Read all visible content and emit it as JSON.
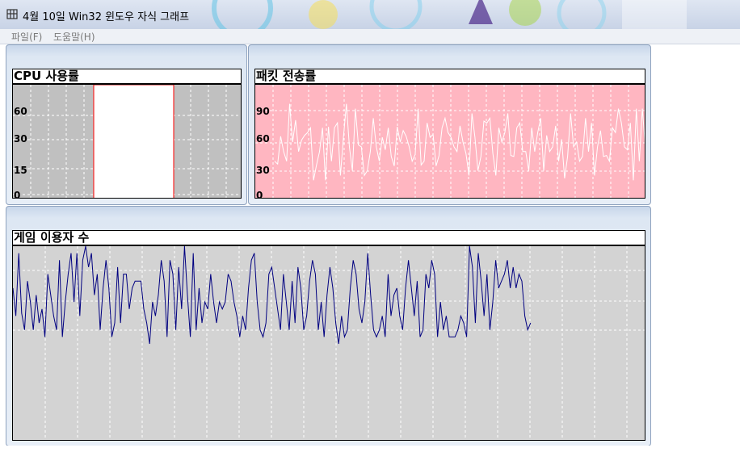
{
  "window": {
    "title": "4월 10일 Win32 윈도우 자식 그래프",
    "icon": "app-window-icon"
  },
  "menu": {
    "file": "파일(F)",
    "help": "도움말(H)"
  },
  "colors": {
    "cpu_bg": "#c0c0c0",
    "cpu_bar_fill": "#ffffff",
    "cpu_bar_border": "#ff0000",
    "packet_bg": "#ffb6c1",
    "packet_line": "#ffffff",
    "users_bg": "#d3d3d3",
    "users_line": "#000080",
    "grid": "#ffffff"
  },
  "charts": {
    "cpu": {
      "title": "CPU 사용률",
      "y_ticks": [
        "60",
        "30",
        "15",
        "0"
      ]
    },
    "packet": {
      "title": "패킷 전송률",
      "y_ticks": [
        "90",
        "60",
        "30",
        "0"
      ]
    },
    "users": {
      "title": "게임 이용자 수"
    }
  },
  "chart_data": [
    {
      "type": "bar",
      "title": "CPU 사용률",
      "ylim": [
        0,
        80
      ],
      "y_ticks": [
        0,
        15,
        30,
        60
      ],
      "values": [
        80
      ]
    },
    {
      "type": "line",
      "title": "패킷 전송률",
      "ylim": [
        0,
        120
      ],
      "y_ticks": [
        0,
        30,
        60,
        90
      ],
      "values": [
        40,
        37,
        66,
        50,
        40,
        100,
        60,
        83,
        50,
        62,
        67,
        70,
        75,
        20,
        36,
        50,
        75,
        20,
        76,
        40,
        75,
        80,
        25,
        65,
        100,
        55,
        30,
        95,
        57,
        55,
        25,
        30,
        50,
        85,
        55,
        40,
        65,
        52,
        75,
        45,
        35,
        76,
        60,
        72,
        66,
        55,
        40,
        47,
        95,
        36,
        40,
        80,
        65,
        68,
        35,
        46,
        75,
        85,
        70,
        65,
        55,
        50,
        77,
        60,
        48,
        25,
        90,
        65,
        30,
        45,
        82,
        80,
        85,
        48,
        25,
        75,
        60,
        70,
        90,
        46,
        45,
        75,
        80,
        50,
        50,
        30,
        75,
        50,
        70,
        85,
        30,
        67,
        50,
        55,
        77,
        40,
        63,
        22,
        45,
        90,
        55,
        60,
        40,
        45,
        85,
        50,
        80,
        25,
        55,
        72,
        45,
        46,
        40,
        75,
        70,
        95,
        80,
        55,
        52,
        80,
        20,
        95,
        40,
        95,
        55,
        70,
        90,
        56,
        82,
        72
      ]
    },
    {
      "type": "line",
      "title": "게임 이용자 수",
      "ylim": [
        0,
        140
      ],
      "values": [
        110,
        90,
        135,
        92,
        80,
        115,
        100,
        80,
        105,
        85,
        95,
        75,
        120,
        105,
        90,
        80,
        130,
        75,
        100,
        120,
        135,
        100,
        135,
        90,
        130,
        140,
        125,
        135,
        105,
        120,
        80,
        110,
        130,
        110,
        75,
        85,
        125,
        85,
        120,
        120,
        95,
        110,
        115,
        115,
        115,
        95,
        85,
        70,
        100,
        90,
        105,
        130,
        115,
        75,
        130,
        120,
        80,
        125,
        95,
        140,
        105,
        75,
        135,
        80,
        110,
        85,
        100,
        95,
        120,
        100,
        85,
        100,
        95,
        100,
        120,
        115,
        100,
        90,
        75,
        90,
        80,
        110,
        130,
        135,
        100,
        80,
        75,
        85,
        120,
        125,
        110,
        95,
        80,
        120,
        100,
        80,
        115,
        85,
        125,
        110,
        80,
        90,
        115,
        130,
        120,
        80,
        100,
        75,
        105,
        125,
        110,
        85,
        70,
        90,
        75,
        80,
        110,
        130,
        120,
        95,
        85,
        100,
        135,
        105,
        80,
        75,
        80,
        90,
        75,
        120,
        90,
        105,
        110,
        90,
        80,
        110,
        130,
        110,
        90,
        115,
        75,
        80,
        120,
        110,
        130,
        120,
        75,
        100,
        80,
        90,
        75,
        75,
        75,
        80,
        90,
        85,
        75,
        140,
        125,
        85,
        135,
        115,
        90,
        120,
        80,
        100,
        130,
        110,
        115,
        120,
        130,
        110,
        125,
        110,
        120,
        115,
        90,
        80,
        85
      ]
    }
  ]
}
